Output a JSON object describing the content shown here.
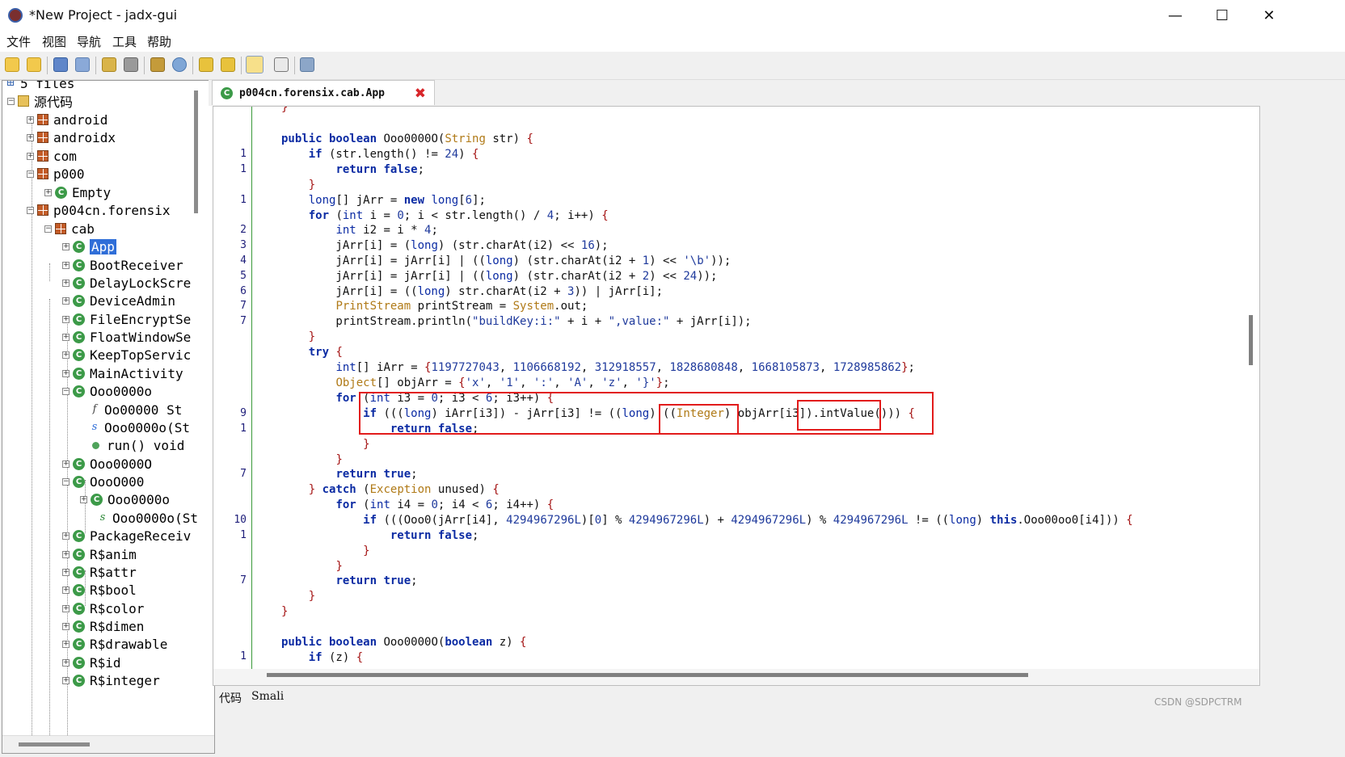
{
  "window": {
    "title": "*New Project - jadx-gui",
    "minimize": "—",
    "maximize": "☐",
    "close": "✕"
  },
  "menu": [
    "文件",
    "视图",
    "导航",
    "工具",
    "帮助"
  ],
  "tree": {
    "root": "5 files",
    "source": "源代码",
    "items": [
      "android",
      "androidx",
      "com",
      "p000",
      "Empty",
      "p004cn.forensix",
      "cab",
      "App",
      "BootReceiver",
      "DelayLockScre",
      "DeviceAdmin",
      "FileEncryptSe",
      "FloatWindowSe",
      "KeepTopServic",
      "MainActivity",
      "Ooo0000o",
      "Oo00000 St",
      "Ooo0000o(St",
      "run() void",
      "Ooo0000O",
      "OooO000",
      "Ooo0000o",
      "Ooo0000o(St",
      "PackageReceiv",
      "R$anim",
      "R$attr",
      "R$bool",
      "R$color",
      "R$dimen",
      "R$drawable",
      "R$id",
      "R$integer"
    ]
  },
  "tab": {
    "name": "p004cn.forensix.cab.App",
    "close": "✖"
  },
  "gutter": [
    "1",
    "1",
    "1",
    "2",
    "3",
    "4",
    "5",
    "6",
    "7",
    "7",
    "9",
    "1",
    "7",
    "10",
    "1",
    "7",
    "1"
  ],
  "code_lines": [
    "    }",
    "    public boolean Ooo0000O(String str) {",
    "        if (str.length() != 24) {",
    "            return false;",
    "        }",
    "        long[] jArr = new long[6];",
    "        for (int i = 0; i < str.length() / 4; i++) {",
    "            int i2 = i * 4;",
    "            jArr[i] = (long) (str.charAt(i2) << 16);",
    "            jArr[i] = jArr[i] | ((long) (str.charAt(i2 + 1) << '\\b'));",
    "            jArr[i] = jArr[i] | ((long) (str.charAt(i2 + 2) << 24));",
    "            jArr[i] = ((long) str.charAt(i2 + 3)) | jArr[i];",
    "            PrintStream printStream = System.out;",
    "            printStream.println(\"buildKey:i:\" + i + \",value:\" + jArr[i]);",
    "        }",
    "        try {",
    "            int[] iArr = {1197727043, 1106668192, 312918557, 1828680848, 1668105873, 1728985862};",
    "            Object[] objArr = {'x', '1', ':', 'A', 'z', '}'};",
    "            for (int i3 = 0; i3 < 6; i3++) {",
    "                if (((long) iArr[i3]) - jArr[i3] != ((long) ((Integer) objArr[i3]).intValue())) {",
    "                    return false;",
    "                }",
    "            }",
    "            return true;",
    "        } catch (Exception unused) {",
    "            for (int i4 = 0; i4 < 6; i4++) {",
    "                if (((Ooo0(jArr[i4], 4294967296L)[0] % 4294967296L) + 4294967296L) % 4294967296L != ((long) this.Ooo00oo0[i4])) {",
    "                    return false;",
    "                }",
    "            }",
    "            return true;",
    "        }",
    "    }",
    "",
    "    public boolean Ooo0000O(boolean z) {",
    "        if (z) {"
  ],
  "bottom_tabs": {
    "code": "代码",
    "smali": "Smali"
  },
  "watermark": "CSDN @SDPCTRM",
  "colors": {
    "keyword": "#0b2ba3",
    "selection": "#2f6ed8",
    "highlight_box": "#e21b1b",
    "class_icon": "#3c9a48",
    "package_icon": "#c35c28"
  }
}
